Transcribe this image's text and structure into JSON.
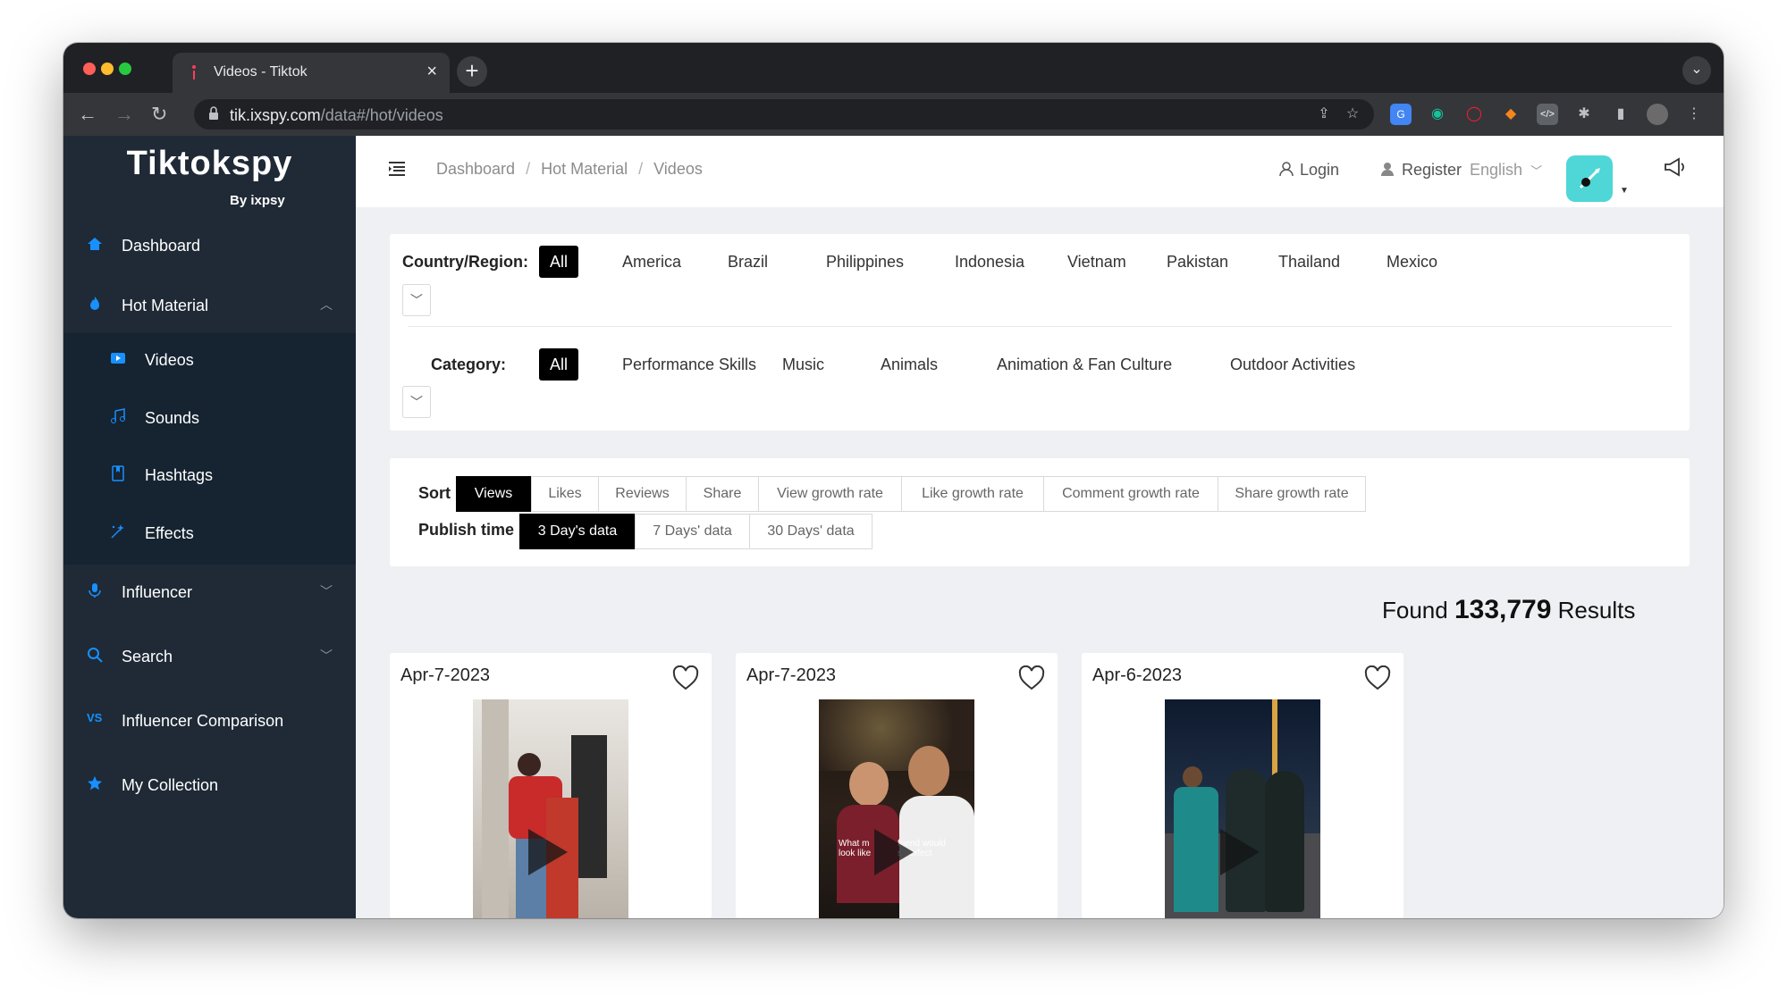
{
  "browser": {
    "tab_title": "Videos - Tiktok",
    "tab_close": "×",
    "new_tab": "+",
    "url_host": "tik.ixspy.com",
    "url_path": "/data#/hot/videos"
  },
  "brand": {
    "name": "Tiktokspy",
    "byline": "By ixpsy"
  },
  "sidebar": {
    "items": [
      {
        "label": "Dashboard",
        "icon": "home-icon"
      },
      {
        "label": "Hot Material",
        "icon": "fire-icon"
      },
      {
        "label": "Influencer",
        "icon": "mic-icon"
      },
      {
        "label": "Search",
        "icon": "search-icon"
      },
      {
        "label": "Influencer Comparison",
        "icon": "vs-icon",
        "icon_text": "VS"
      },
      {
        "label": "My Collection",
        "icon": "star-icon"
      }
    ],
    "sub_items": [
      {
        "label": "Videos",
        "icon": "video-icon"
      },
      {
        "label": "Sounds",
        "icon": "music-icon"
      },
      {
        "label": "Hashtags",
        "icon": "bookmark-icon"
      },
      {
        "label": "Effects",
        "icon": "sparkle-icon"
      }
    ]
  },
  "header": {
    "breadcrumb": [
      "Dashboard",
      "Hot Material",
      "Videos"
    ],
    "breadcrumb_sep": "/",
    "login": "Login",
    "register": "Register",
    "language": "English"
  },
  "filters": {
    "country_label": "Country/Region:",
    "countries": [
      "All",
      "America",
      "Brazil",
      "Philippines",
      "Indonesia",
      "Vietnam",
      "Pakistan",
      "Thailand",
      "Mexico"
    ],
    "category_label": "Category:",
    "categories": [
      "All",
      "Performance Skills",
      "Music",
      "Animals",
      "Animation & Fan Culture",
      "Outdoor Activities"
    ],
    "sort_label": "Sort",
    "sort_options": [
      "Views",
      "Likes",
      "Reviews",
      "Share",
      "View growth rate",
      "Like growth rate",
      "Comment growth rate",
      "Share growth rate"
    ],
    "publish_label": "Publish time",
    "publish_options": [
      "3 Day's data",
      "7 Days' data",
      "30 Days' data"
    ]
  },
  "results": {
    "prefix": "Found",
    "count": "133,779",
    "suffix": "Results"
  },
  "cards": [
    {
      "date": "Apr-7-2023"
    },
    {
      "date": "Apr-7-2023",
      "caption_left": "What m\nlook like",
      "caption_right": "friend would\ns perfect"
    },
    {
      "date": "Apr-6-2023"
    }
  ],
  "colors": {
    "sidebar_bg": "#1f2a36",
    "accent": "#1890ff",
    "active_chip": "#000000",
    "avatar": "#4fd6d6"
  }
}
